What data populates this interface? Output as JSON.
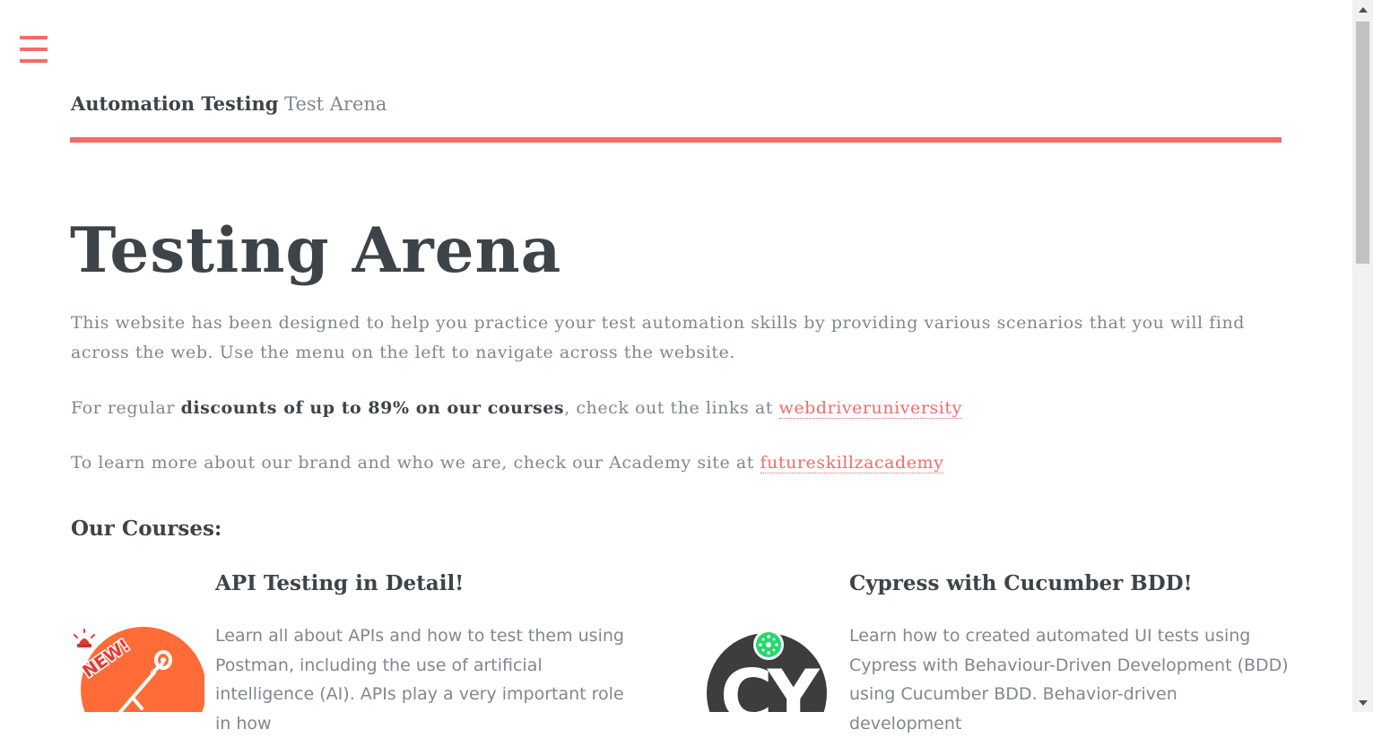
{
  "header": {
    "brand_bold": "Automation Testing",
    "brand_light": "Test Arena"
  },
  "main": {
    "title": "Testing Arena",
    "intro": "This website has been designed to help you practice your test automation skills by providing various scenarios that you will find across the web. Use the menu on the left to navigate across the website.",
    "discounts": {
      "prefix": "For regular ",
      "bold": "discounts of up to 89% on our courses",
      "middle": ", check out the links at ",
      "link": "webdriveruniversity"
    },
    "academy": {
      "prefix": "To learn more about our brand and who we are, check our Academy site at ",
      "link": "futureskillzacademy"
    },
    "courses_heading": "Our Courses:",
    "courses": [
      {
        "title": "API Testing in Detail!",
        "description": "Learn all about APIs and how to test them using Postman, including the use of artificial intelligence (AI). APIs play a very important role in how",
        "icon": "postman-icon",
        "badge": "NEW!"
      },
      {
        "title": "Cypress with Cucumber BDD!",
        "description": "Learn how to created automated UI tests using Cypress with Behaviour-Driven Development (BDD) using Cucumber BDD. Behavior-driven development",
        "icon": "cucumber-cypress-icon",
        "icon_text": "CY"
      }
    ]
  },
  "colors": {
    "accent": "#f56a6a",
    "text_dark": "#3d4449",
    "text_muted": "#7f888f",
    "postman_orange": "#ff6c37",
    "cucumber_green": "#23d96c"
  }
}
